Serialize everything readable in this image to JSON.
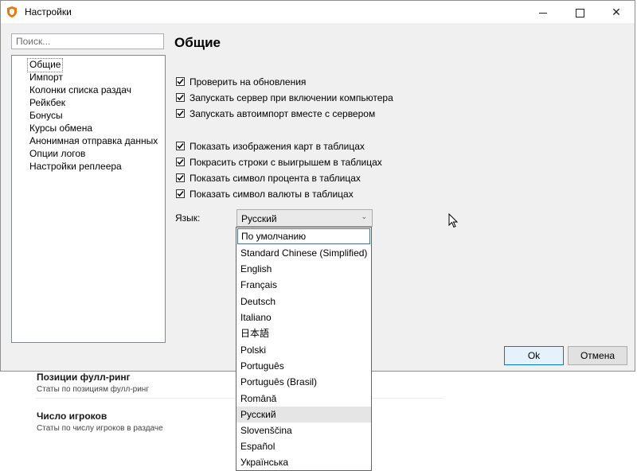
{
  "window": {
    "title": "Настройки",
    "icon": "shield-icon"
  },
  "search": {
    "placeholder": "Поиск..."
  },
  "nav": {
    "items": [
      "Общие",
      "Импорт",
      "Колонки списка раздач",
      "Рейкбек",
      "Бонусы",
      "Курсы обмена",
      "Анонимная отправка данных",
      "Опции логов",
      "Настройки реплеера"
    ],
    "selected": "Общие"
  },
  "section": {
    "title": "Общие"
  },
  "checkboxes": [
    {
      "label": "Проверить на обновления",
      "checked": true
    },
    {
      "label": "Запускать сервер при включении компьютера",
      "checked": true
    },
    {
      "label": "Запускать автоимпорт вместе с сервером",
      "checked": true
    },
    {
      "label": "Показать изображения карт в таблицах",
      "checked": true
    },
    {
      "label": "Покрасить строки с выигрышем в таблицах",
      "checked": true
    },
    {
      "label": "Показать символ процента в таблицах",
      "checked": true
    },
    {
      "label": "Показать символ валюты в таблицах",
      "checked": true
    }
  ],
  "language": {
    "label": "Язык:",
    "selected": "Русский",
    "options": [
      "По умолчанию",
      "Standard Chinese (Simplified)",
      "English",
      "Français",
      "Deutsch",
      "Italiano",
      "日本語",
      "Polski",
      "Português",
      "Português (Brasil)",
      "Română",
      "Русский",
      "Slovenščina",
      "Español",
      "Українська"
    ]
  },
  "buttons": {
    "ok": "Ok",
    "cancel": "Отмена"
  },
  "background": {
    "items": [
      {
        "title": "Позиции фулл-ринг",
        "subtitle": "Статы по позициям фулл-ринг"
      },
      {
        "title": "Число игроков",
        "subtitle": "Статы по числу игроков в раздаче"
      }
    ]
  },
  "colors": {
    "accent": "#0078d7",
    "icon": "#e8790f"
  }
}
